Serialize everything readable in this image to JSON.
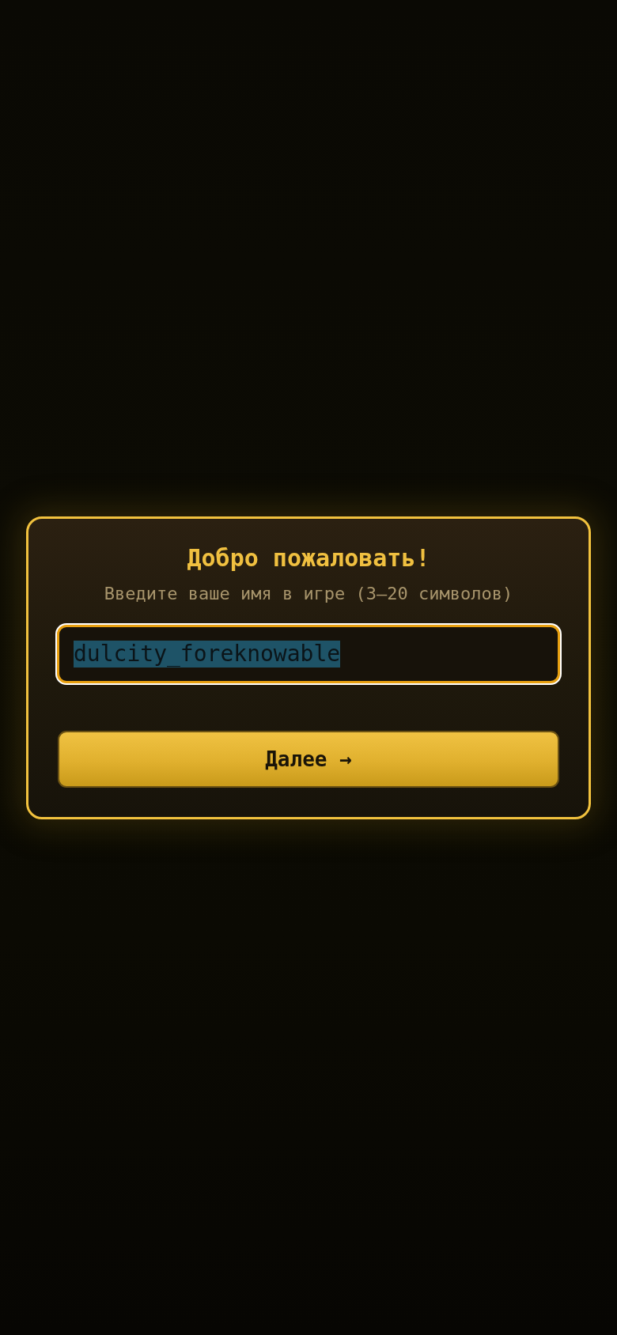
{
  "dialog": {
    "title": "Добро пожаловать!",
    "subtitle": "Введите ваше имя в игре (3–20 символов)",
    "name_field": {
      "value": "dulcity_foreknowable",
      "focused": true,
      "text_selected": true
    },
    "next_button": {
      "label": "Далее →"
    }
  }
}
